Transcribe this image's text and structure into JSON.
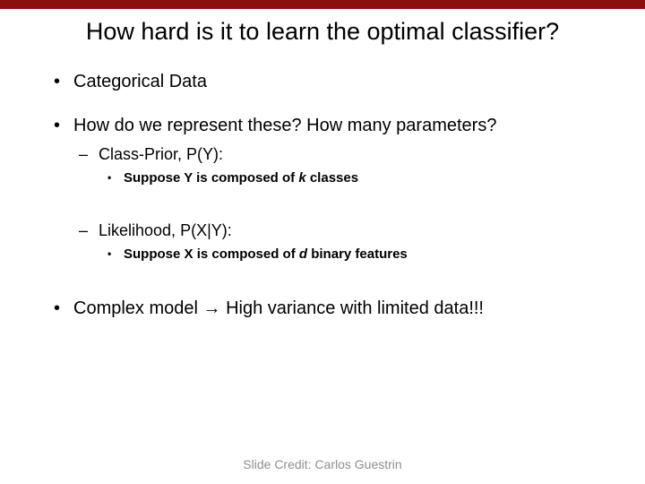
{
  "title": "How hard is it to learn the optimal classifier?",
  "bullets": {
    "b1": "Categorical Data",
    "b2": "How do we represent these? How many parameters?",
    "b2_1": "Class-Prior, P(Y):",
    "b2_1_1_pre": "Suppose Y is composed of ",
    "b2_1_1_it": "k",
    "b2_1_1_post": " classes",
    "b2_2": "Likelihood, P(X|Y):",
    "b2_2_1_pre": "Suppose ",
    "b2_2_1_bold": "X",
    "b2_2_1_mid": " is composed of ",
    "b2_2_1_it": "d",
    "b2_2_1_post": " binary features",
    "b3_pre": "Complex model ",
    "b3_arrow": "→",
    "b3_post": " High variance with limited data!!!"
  },
  "credit": "Slide Credit: Carlos Guestrin"
}
